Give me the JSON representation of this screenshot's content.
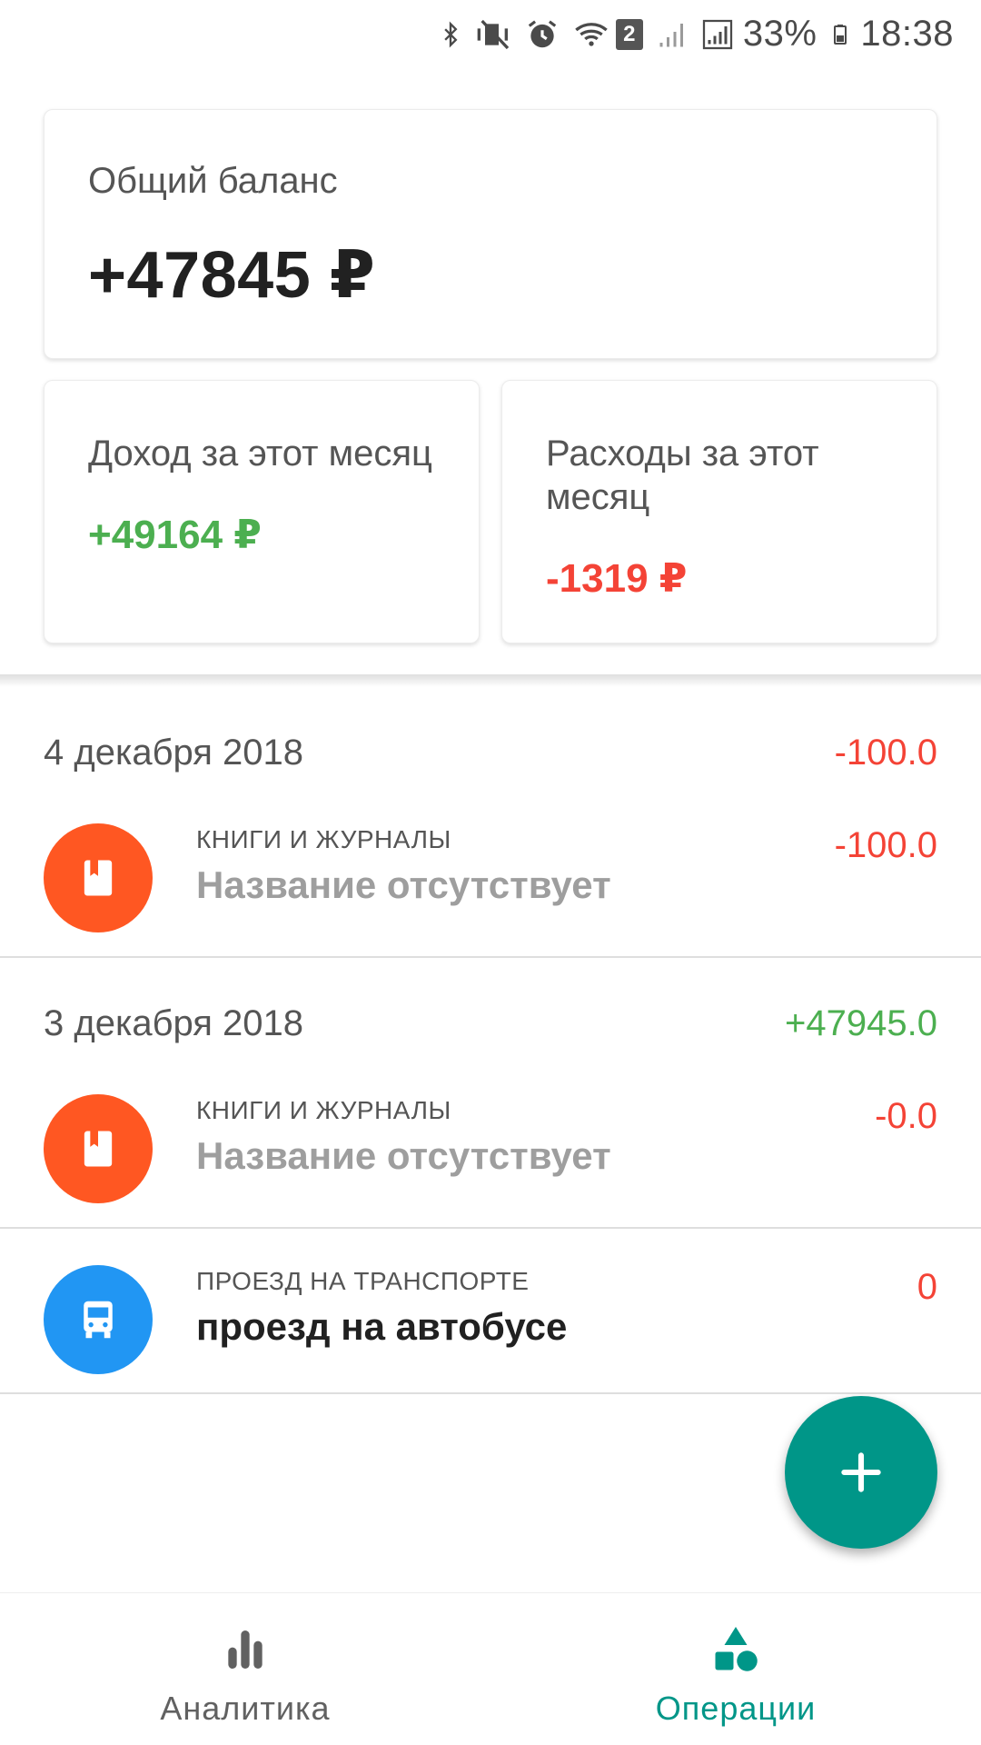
{
  "status_bar": {
    "battery": "33%",
    "time": "18:38",
    "sim_badge": "2",
    "icons": [
      "bluetooth-icon",
      "vibrate-off-icon",
      "alarm-icon",
      "wifi-icon",
      "signal-icon",
      "signal-icon",
      "battery-icon"
    ]
  },
  "summary": {
    "total_label": "Общий баланс",
    "total_value": "+47845 ₽",
    "income_label": "Доход за этот месяц",
    "income_value": "+49164 ₽",
    "expense_label": "Расходы за этот месяц",
    "expense_value": "-1319 ₽"
  },
  "days": [
    {
      "date": "4 декабря 2018",
      "total": "-100.0",
      "total_color": "#f44336",
      "operations": [
        {
          "category": "КНИГИ И ЖУРНАЛЫ",
          "name": "Название отсутствует",
          "amount": "-100.0",
          "icon": "book-icon",
          "icon_color": "#ff5722"
        }
      ]
    },
    {
      "date": "3 декабря 2018",
      "total": "+47945.0",
      "total_color": "#4caf50",
      "operations": [
        {
          "category": "КНИГИ И ЖУРНАЛЫ",
          "name": "Название отсутствует",
          "amount": "-0.0",
          "icon": "book-icon",
          "icon_color": "#ff5722"
        },
        {
          "category": "ПРОЕЗД НА ТРАНСПОРТЕ",
          "name": "проезд на автобусе",
          "amount": "0",
          "icon": "bus-icon",
          "icon_color": "#2196f3"
        }
      ]
    }
  ],
  "fab": {
    "icon": "plus-icon",
    "color": "#009688"
  },
  "bottom_nav": {
    "analytics_label": "Аналитика",
    "operations_label": "Операции",
    "active": "operations",
    "accent": "#009688"
  }
}
